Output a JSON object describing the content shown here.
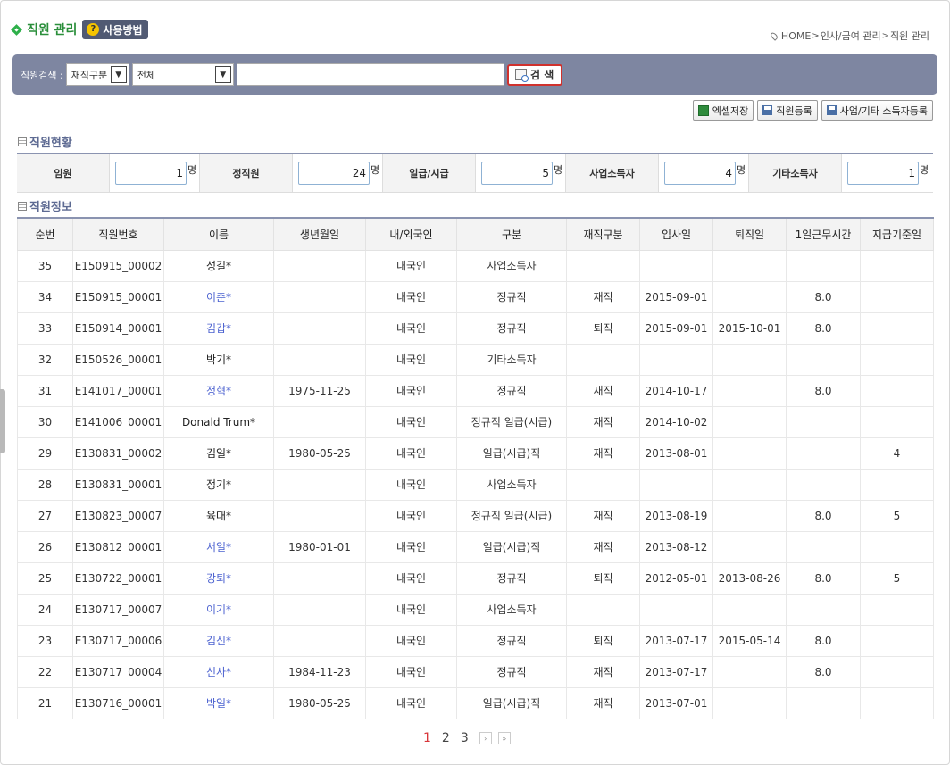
{
  "header": {
    "title": "직원 관리",
    "help_label": "사용방법",
    "help_icon": "question-icon"
  },
  "breadcrumb": [
    "HOME",
    "인사/급여 관리",
    "직원 관리"
  ],
  "search": {
    "label": "직원검색 :",
    "filter_select": "재직구분",
    "value_select": "전체",
    "query": "",
    "button_label": "검 색"
  },
  "actions": {
    "excel": "엑셀저장",
    "register": "직원등록",
    "register_other": "사업/기타 소득자등록"
  },
  "status_section": {
    "title": "직원현황"
  },
  "stats": [
    {
      "label": "임원",
      "value": "1",
      "unit": "명"
    },
    {
      "label": "정직원",
      "value": "24",
      "unit": "명"
    },
    {
      "label": "일급/시급",
      "value": "5",
      "unit": "명"
    },
    {
      "label": "사업소득자",
      "value": "4",
      "unit": "명"
    },
    {
      "label": "기타소득자",
      "value": "1",
      "unit": "명"
    }
  ],
  "info_section": {
    "title": "직원정보"
  },
  "table": {
    "columns": [
      "순번",
      "직원번호",
      "이름",
      "생년월일",
      "내/외국인",
      "구분",
      "재직구분",
      "입사일",
      "퇴직일",
      "1일근무시간",
      "지급기준일"
    ],
    "rows": [
      {
        "no": "35",
        "id": "E150915_00002",
        "name": "성길*",
        "link": false,
        "birth": "",
        "nat": "내국인",
        "type": "사업소득자",
        "status": "",
        "join": "",
        "leave": "",
        "hours": "",
        "payday": ""
      },
      {
        "no": "34",
        "id": "E150915_00001",
        "name": "이춘*",
        "link": true,
        "birth": "",
        "nat": "내국인",
        "type": "정규직",
        "status": "재직",
        "join": "2015-09-01",
        "leave": "",
        "hours": "8.0",
        "payday": ""
      },
      {
        "no": "33",
        "id": "E150914_00001",
        "name": "김갑*",
        "link": true,
        "birth": "",
        "nat": "내국인",
        "type": "정규직",
        "status": "퇴직",
        "join": "2015-09-01",
        "leave": "2015-10-01",
        "hours": "8.0",
        "payday": ""
      },
      {
        "no": "32",
        "id": "E150526_00001",
        "name": "박기*",
        "link": false,
        "birth": "",
        "nat": "내국인",
        "type": "기타소득자",
        "status": "",
        "join": "",
        "leave": "",
        "hours": "",
        "payday": ""
      },
      {
        "no": "31",
        "id": "E141017_00001",
        "name": "정혁*",
        "link": true,
        "birth": "1975-11-25",
        "nat": "내국인",
        "type": "정규직",
        "status": "재직",
        "join": "2014-10-17",
        "leave": "",
        "hours": "8.0",
        "payday": ""
      },
      {
        "no": "30",
        "id": "E141006_00001",
        "name": "Donald Trum*",
        "link": false,
        "birth": "",
        "nat": "내국인",
        "type": "정규직 일급(시급)",
        "status": "재직",
        "join": "2014-10-02",
        "leave": "",
        "hours": "",
        "payday": ""
      },
      {
        "no": "29",
        "id": "E130831_00002",
        "name": "김일*",
        "link": false,
        "birth": "1980-05-25",
        "nat": "내국인",
        "type": "일급(시급)직",
        "status": "재직",
        "join": "2013-08-01",
        "leave": "",
        "hours": "",
        "payday": "4"
      },
      {
        "no": "28",
        "id": "E130831_00001",
        "name": "정기*",
        "link": false,
        "birth": "",
        "nat": "내국인",
        "type": "사업소득자",
        "status": "",
        "join": "",
        "leave": "",
        "hours": "",
        "payday": ""
      },
      {
        "no": "27",
        "id": "E130823_00007",
        "name": "육대*",
        "link": false,
        "birth": "",
        "nat": "내국인",
        "type": "정규직 일급(시급)",
        "status": "재직",
        "join": "2013-08-19",
        "leave": "",
        "hours": "8.0",
        "payday": "5"
      },
      {
        "no": "26",
        "id": "E130812_00001",
        "name": "서일*",
        "link": true,
        "birth": "1980-01-01",
        "nat": "내국인",
        "type": "일급(시급)직",
        "status": "재직",
        "join": "2013-08-12",
        "leave": "",
        "hours": "",
        "payday": ""
      },
      {
        "no": "25",
        "id": "E130722_00001",
        "name": "강퇴*",
        "link": true,
        "birth": "",
        "nat": "내국인",
        "type": "정규직",
        "status": "퇴직",
        "join": "2012-05-01",
        "leave": "2013-08-26",
        "hours": "8.0",
        "payday": "5"
      },
      {
        "no": "24",
        "id": "E130717_00007",
        "name": "이기*",
        "link": true,
        "birth": "",
        "nat": "내국인",
        "type": "사업소득자",
        "status": "",
        "join": "",
        "leave": "",
        "hours": "",
        "payday": ""
      },
      {
        "no": "23",
        "id": "E130717_00006",
        "name": "김신*",
        "link": true,
        "birth": "",
        "nat": "내국인",
        "type": "정규직",
        "status": "퇴직",
        "join": "2013-07-17",
        "leave": "2015-05-14",
        "hours": "8.0",
        "payday": ""
      },
      {
        "no": "22",
        "id": "E130717_00004",
        "name": "신사*",
        "link": true,
        "birth": "1984-11-23",
        "nat": "내국인",
        "type": "정규직",
        "status": "재직",
        "join": "2013-07-17",
        "leave": "",
        "hours": "8.0",
        "payday": ""
      },
      {
        "no": "21",
        "id": "E130716_00001",
        "name": "박일*",
        "link": true,
        "birth": "1980-05-25",
        "nat": "내국인",
        "type": "일급(시급)직",
        "status": "재직",
        "join": "2013-07-01",
        "leave": "",
        "hours": "",
        "payday": ""
      }
    ]
  },
  "pagination": {
    "pages": [
      "1",
      "2",
      "3"
    ],
    "current": "1",
    "next": "›",
    "last": "»"
  },
  "colors": {
    "accent": "#7e86a1",
    "title_green": "#2a8e3a",
    "link_blue": "#4c62d0",
    "search_border": "#d0312d"
  }
}
